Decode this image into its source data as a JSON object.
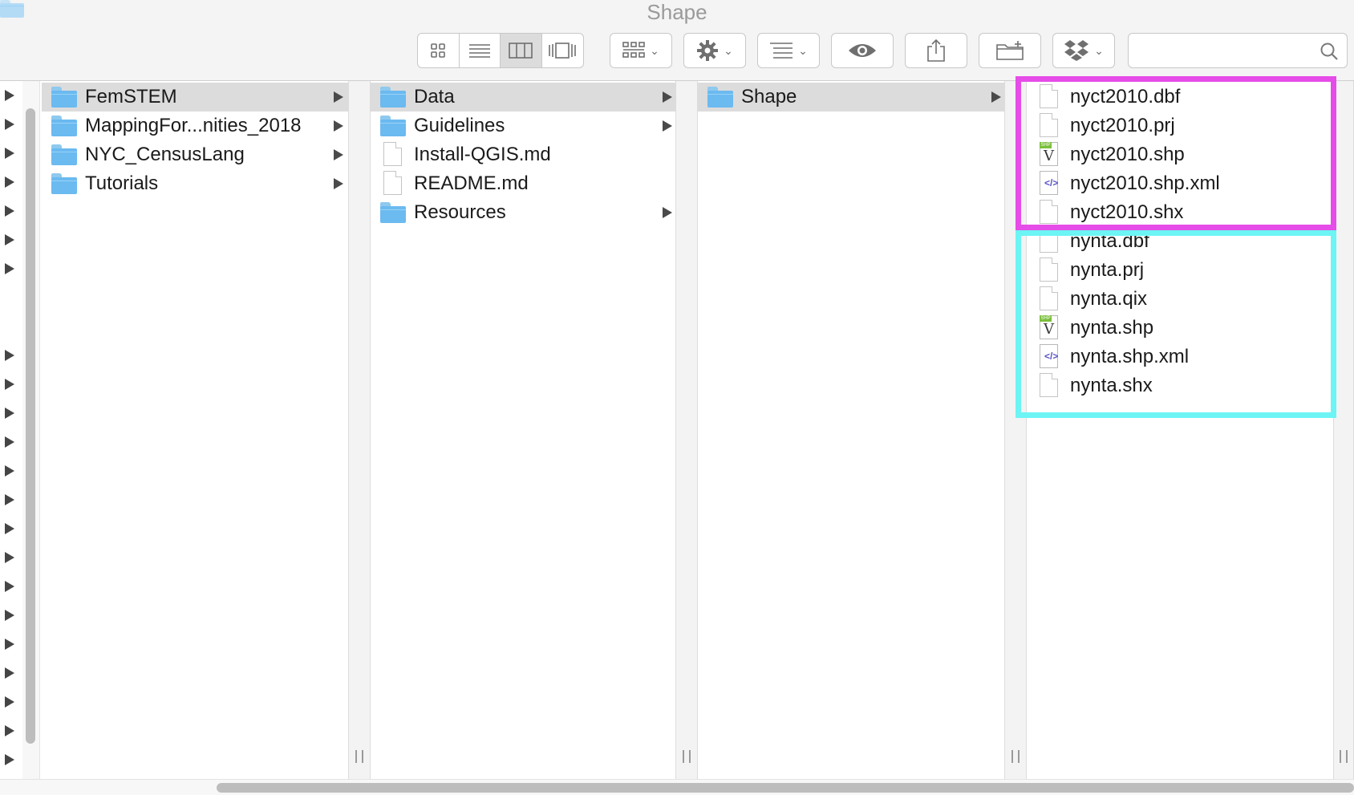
{
  "window": {
    "title": "Shape",
    "title_icon": "folder-icon"
  },
  "toolbar": {
    "view_buttons": [
      "icon-view-icon",
      "list-view-icon",
      "column-view-icon",
      "cover-flow-icon"
    ],
    "active_view": "column-view-icon",
    "group_button": "group-by-icon",
    "action_button": "gear-icon",
    "arrange_button": "arrange-icon",
    "quicklook_button": "eye-icon",
    "share_button": "share-icon",
    "new_folder_button": "new-folder-icon",
    "dropbox_button": "dropbox-icon",
    "search": {
      "placeholder": "",
      "value": "",
      "icon": "search-icon"
    }
  },
  "columns": [
    {
      "items": [
        {
          "name": "FemSTEM",
          "type": "folder",
          "selected": true,
          "has_children": true
        },
        {
          "name": "MappingFor...nities_2018",
          "type": "folder",
          "selected": false,
          "has_children": true
        },
        {
          "name": "NYC_CensusLang",
          "type": "folder",
          "selected": false,
          "has_children": true
        },
        {
          "name": "Tutorials",
          "type": "folder",
          "selected": false,
          "has_children": true
        }
      ]
    },
    {
      "items": [
        {
          "name": "Data",
          "type": "folder",
          "selected": true,
          "has_children": true
        },
        {
          "name": "Guidelines",
          "type": "folder",
          "selected": false,
          "has_children": true
        },
        {
          "name": "Install-QGIS.md",
          "type": "file",
          "selected": false,
          "has_children": false
        },
        {
          "name": "README.md",
          "type": "file",
          "selected": false,
          "has_children": false
        },
        {
          "name": "Resources",
          "type": "folder",
          "selected": false,
          "has_children": true
        }
      ]
    },
    {
      "items": [
        {
          "name": "Shape",
          "type": "folder",
          "selected": true,
          "has_children": true
        }
      ]
    },
    {
      "items": [
        {
          "name": "nyct2010.dbf",
          "type": "file"
        },
        {
          "name": "nyct2010.prj",
          "type": "file"
        },
        {
          "name": "nyct2010.shp",
          "type": "shp"
        },
        {
          "name": "nyct2010.shp.xml",
          "type": "xml"
        },
        {
          "name": "nyct2010.shx",
          "type": "file"
        },
        {
          "name": "nynta.dbf",
          "type": "file"
        },
        {
          "name": "nynta.prj",
          "type": "file"
        },
        {
          "name": "nynta.qix",
          "type": "file"
        },
        {
          "name": "nynta.shp",
          "type": "shp"
        },
        {
          "name": "nynta.shp.xml",
          "type": "xml"
        },
        {
          "name": "nynta.shx",
          "type": "file"
        }
      ]
    }
  ],
  "annotations": {
    "magenta_group_color": "#e54ce8",
    "cyan_group_color": "#6df4f4"
  },
  "colors": {
    "selection": "#dcdcdc",
    "folder": "#6bbaf0",
    "toolbar_bg": "#f4f4f4"
  }
}
